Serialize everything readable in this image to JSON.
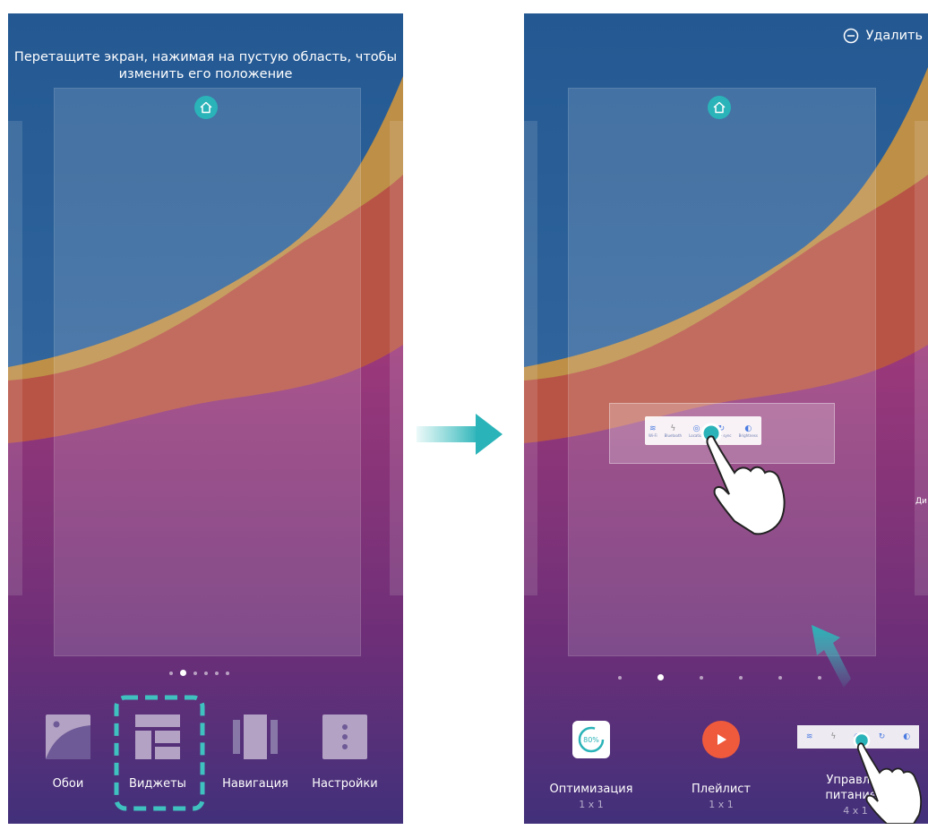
{
  "left_screen": {
    "hint_text": "Перетащите экран, нажимая на пустую область, чтобы изменить его положение",
    "toolbar": [
      {
        "label": "Обои",
        "icon": "wallpaper-icon"
      },
      {
        "label": "Виджеты",
        "icon": "widgets-icon"
      },
      {
        "label": "Навигация",
        "icon": "navigation-icon"
      },
      {
        "label": "Настройки",
        "icon": "settings-icon"
      }
    ]
  },
  "right_screen": {
    "delete_label": "Удалить",
    "side_label": "Ди",
    "widget_items": [
      "Wi-Fi",
      "Bluetooth",
      "Location",
      "Auto - sync",
      "Brightness"
    ],
    "widgets": [
      {
        "label": "Оптимизация",
        "size": "1 x 1",
        "badge": "80%"
      },
      {
        "label": "Плейлист",
        "size": "1 x 1"
      },
      {
        "label": "Управление питанием",
        "label_visible": "Управлен питанием",
        "size": "4 x 1"
      }
    ]
  },
  "colors": {
    "accent": "#2ab3b8",
    "play": "#ef5a3c",
    "highlight_dashes": "#3fc1c0"
  }
}
